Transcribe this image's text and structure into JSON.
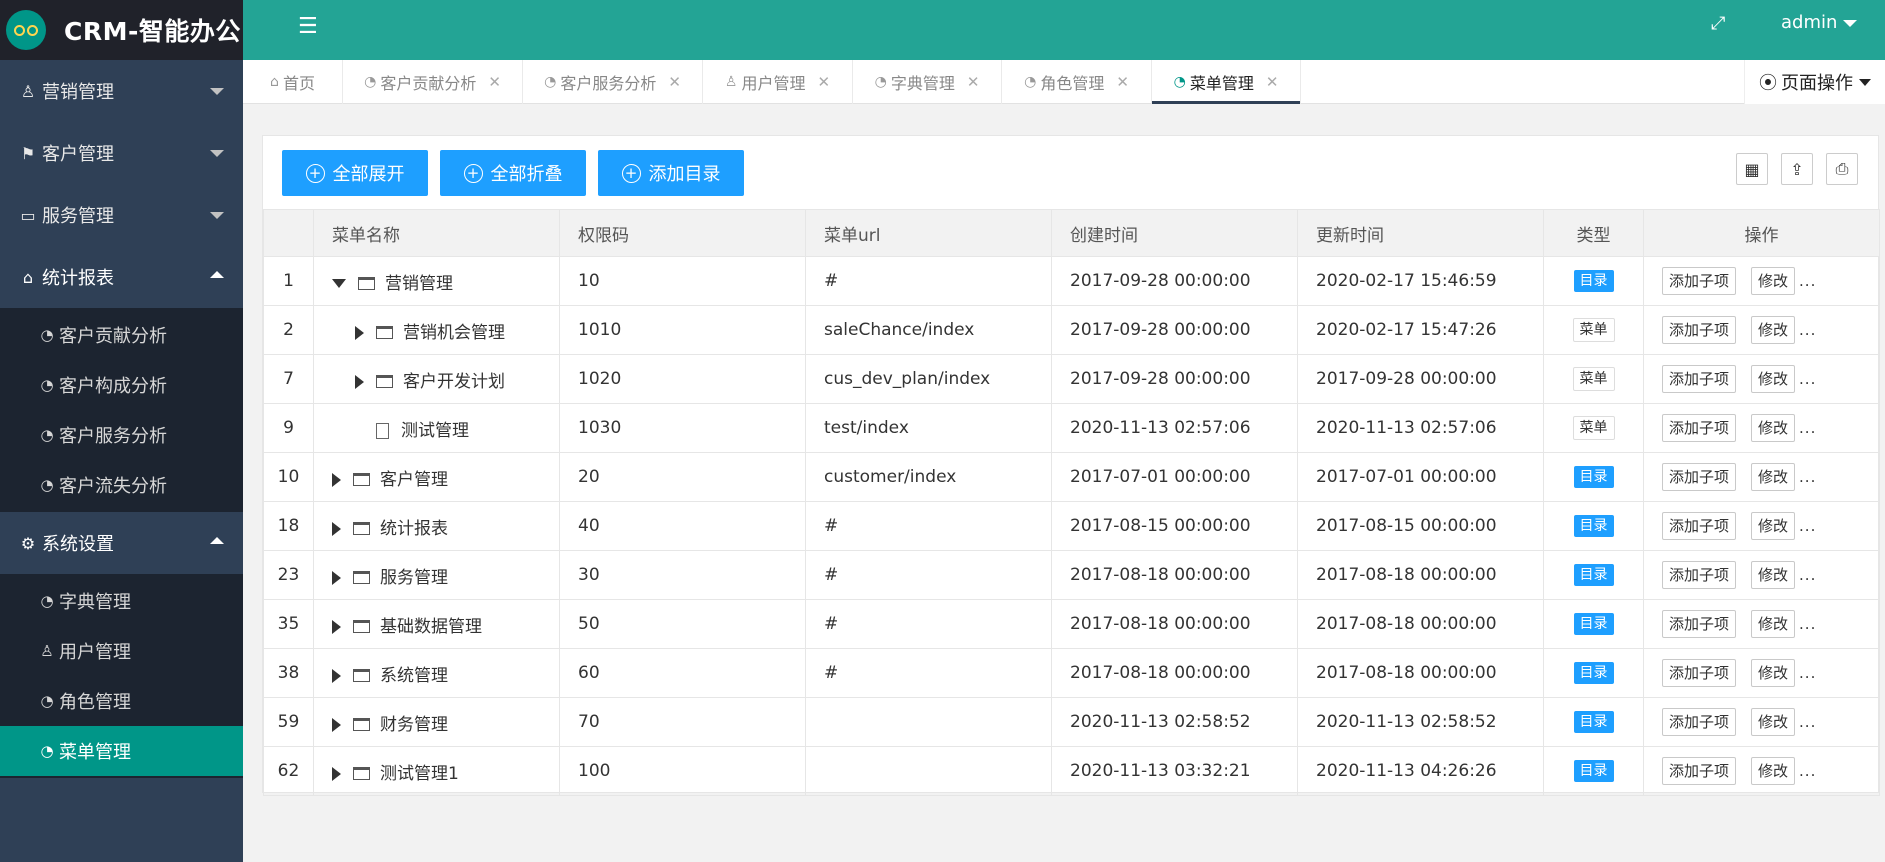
{
  "app": {
    "title": "CRM-智能办公"
  },
  "sidebar": {
    "groups": [
      {
        "label": "营销管理",
        "icon": "user-icon",
        "open": false
      },
      {
        "label": "客户管理",
        "icon": "flag-icon",
        "open": false
      },
      {
        "label": "服务管理",
        "icon": "desktop-icon",
        "open": false
      },
      {
        "label": "统计报表",
        "icon": "home-icon",
        "open": true,
        "items": [
          "客户贡献分析",
          "客户构成分析",
          "客户服务分析",
          "客户流失分析"
        ]
      },
      {
        "label": "系统设置",
        "icon": "gears-icon",
        "open": true,
        "items": [
          "字典管理",
          "用户管理",
          "角色管理",
          "菜单管理"
        ]
      }
    ],
    "active_item": "菜单管理"
  },
  "header": {
    "user": "admin"
  },
  "tabs": [
    {
      "label": "首页",
      "closable": false
    },
    {
      "label": "客户贡献分析",
      "closable": true
    },
    {
      "label": "客户服务分析",
      "closable": true
    },
    {
      "label": "用户管理",
      "closable": true
    },
    {
      "label": "字典管理",
      "closable": true
    },
    {
      "label": "角色管理",
      "closable": true
    },
    {
      "label": "菜单管理",
      "closable": true,
      "active": true
    }
  ],
  "page_ops": "页面操作",
  "toolbar": {
    "expand_all": "全部展开",
    "collapse_all": "全部折叠",
    "add_dir": "添加目录"
  },
  "table": {
    "headers": [
      "",
      "菜单名称",
      "权限码",
      "菜单url",
      "创建时间",
      "更新时间",
      "类型",
      "操作"
    ],
    "actions": {
      "add_child": "添加子项",
      "edit": "修改",
      "more": "..."
    },
    "rows": [
      {
        "id": "1",
        "name": "营销管理",
        "level": 0,
        "toggle": "down",
        "kind": "folder",
        "code": "10",
        "url": "#",
        "created": "2017-09-28 00:00:00",
        "updated": "2020-02-17 15:46:59",
        "type": "目录"
      },
      {
        "id": "2",
        "name": "营销机会管理",
        "level": 1,
        "toggle": "right",
        "kind": "folder",
        "code": "1010",
        "url": "saleChance/index",
        "created": "2017-09-28 00:00:00",
        "updated": "2020-02-17 15:47:26",
        "type": "菜单"
      },
      {
        "id": "7",
        "name": "客户开发计划",
        "level": 1,
        "toggle": "right",
        "kind": "folder",
        "code": "1020",
        "url": "cus_dev_plan/index",
        "created": "2017-09-28 00:00:00",
        "updated": "2017-09-28 00:00:00",
        "type": "菜单"
      },
      {
        "id": "9",
        "name": "测试管理",
        "level": 1,
        "toggle": "none",
        "kind": "file",
        "code": "1030",
        "url": "test/index",
        "created": "2020-11-13 02:57:06",
        "updated": "2020-11-13 02:57:06",
        "type": "菜单"
      },
      {
        "id": "10",
        "name": "客户管理",
        "level": 0,
        "toggle": "right",
        "kind": "folder",
        "code": "20",
        "url": "customer/index",
        "created": "2017-07-01 00:00:00",
        "updated": "2017-07-01 00:00:00",
        "type": "目录"
      },
      {
        "id": "18",
        "name": "统计报表",
        "level": 0,
        "toggle": "right",
        "kind": "folder",
        "code": "40",
        "url": "#",
        "created": "2017-08-15 00:00:00",
        "updated": "2017-08-15 00:00:00",
        "type": "目录"
      },
      {
        "id": "23",
        "name": "服务管理",
        "level": 0,
        "toggle": "right",
        "kind": "folder",
        "code": "30",
        "url": "#",
        "created": "2017-08-18 00:00:00",
        "updated": "2017-08-18 00:00:00",
        "type": "目录"
      },
      {
        "id": "35",
        "name": "基础数据管理",
        "level": 0,
        "toggle": "right",
        "kind": "folder",
        "code": "50",
        "url": "#",
        "created": "2017-08-18 00:00:00",
        "updated": "2017-08-18 00:00:00",
        "type": "目录"
      },
      {
        "id": "38",
        "name": "系统管理",
        "level": 0,
        "toggle": "right",
        "kind": "folder",
        "code": "60",
        "url": "#",
        "created": "2017-08-18 00:00:00",
        "updated": "2017-08-18 00:00:00",
        "type": "目录"
      },
      {
        "id": "59",
        "name": "财务管理",
        "level": 0,
        "toggle": "right",
        "kind": "folder",
        "code": "70",
        "url": "",
        "created": "2020-11-13 02:58:52",
        "updated": "2020-11-13 02:58:52",
        "type": "目录"
      },
      {
        "id": "62",
        "name": "测试管理1",
        "level": 0,
        "toggle": "right",
        "kind": "folder",
        "code": "100",
        "url": "",
        "created": "2020-11-13 03:32:21",
        "updated": "2020-11-13 04:26:26",
        "type": "目录"
      }
    ]
  }
}
